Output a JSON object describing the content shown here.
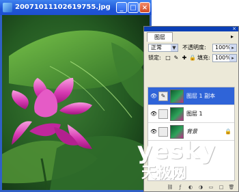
{
  "window": {
    "title": "20071011102619755.jpg @ 10...",
    "controls": {
      "minimize": "_",
      "maximize": "□",
      "close": "×"
    }
  },
  "photo": {
    "subject": "pink lotus flower with large green leaves"
  },
  "layers_panel": {
    "tab_label": "图层",
    "close_glyph": "×",
    "menu_glyph": "▸",
    "blend_mode": "正常",
    "opacity_label": "不透明度:",
    "opacity_value": "100%",
    "lock_label": "锁定:",
    "fill_label": "填充:",
    "fill_value": "100%",
    "lock_icons": [
      "lock-transparent-icon",
      "lock-brush-icon",
      "lock-move-icon",
      "lock-all-icon"
    ],
    "layers": [
      {
        "name": "图层 1 副本",
        "active": true,
        "visible": true
      },
      {
        "name": "图层 1",
        "active": false,
        "visible": true
      },
      {
        "name": "背景",
        "active": false,
        "visible": true,
        "locked": true
      }
    ],
    "bottom_icons": [
      "link-icon",
      "effects-icon",
      "mask-icon",
      "adjustment-icon",
      "folder-icon",
      "new-layer-icon",
      "trash-icon"
    ]
  },
  "watermark": {
    "main": "yesky",
    "sub": "天极网"
  }
}
